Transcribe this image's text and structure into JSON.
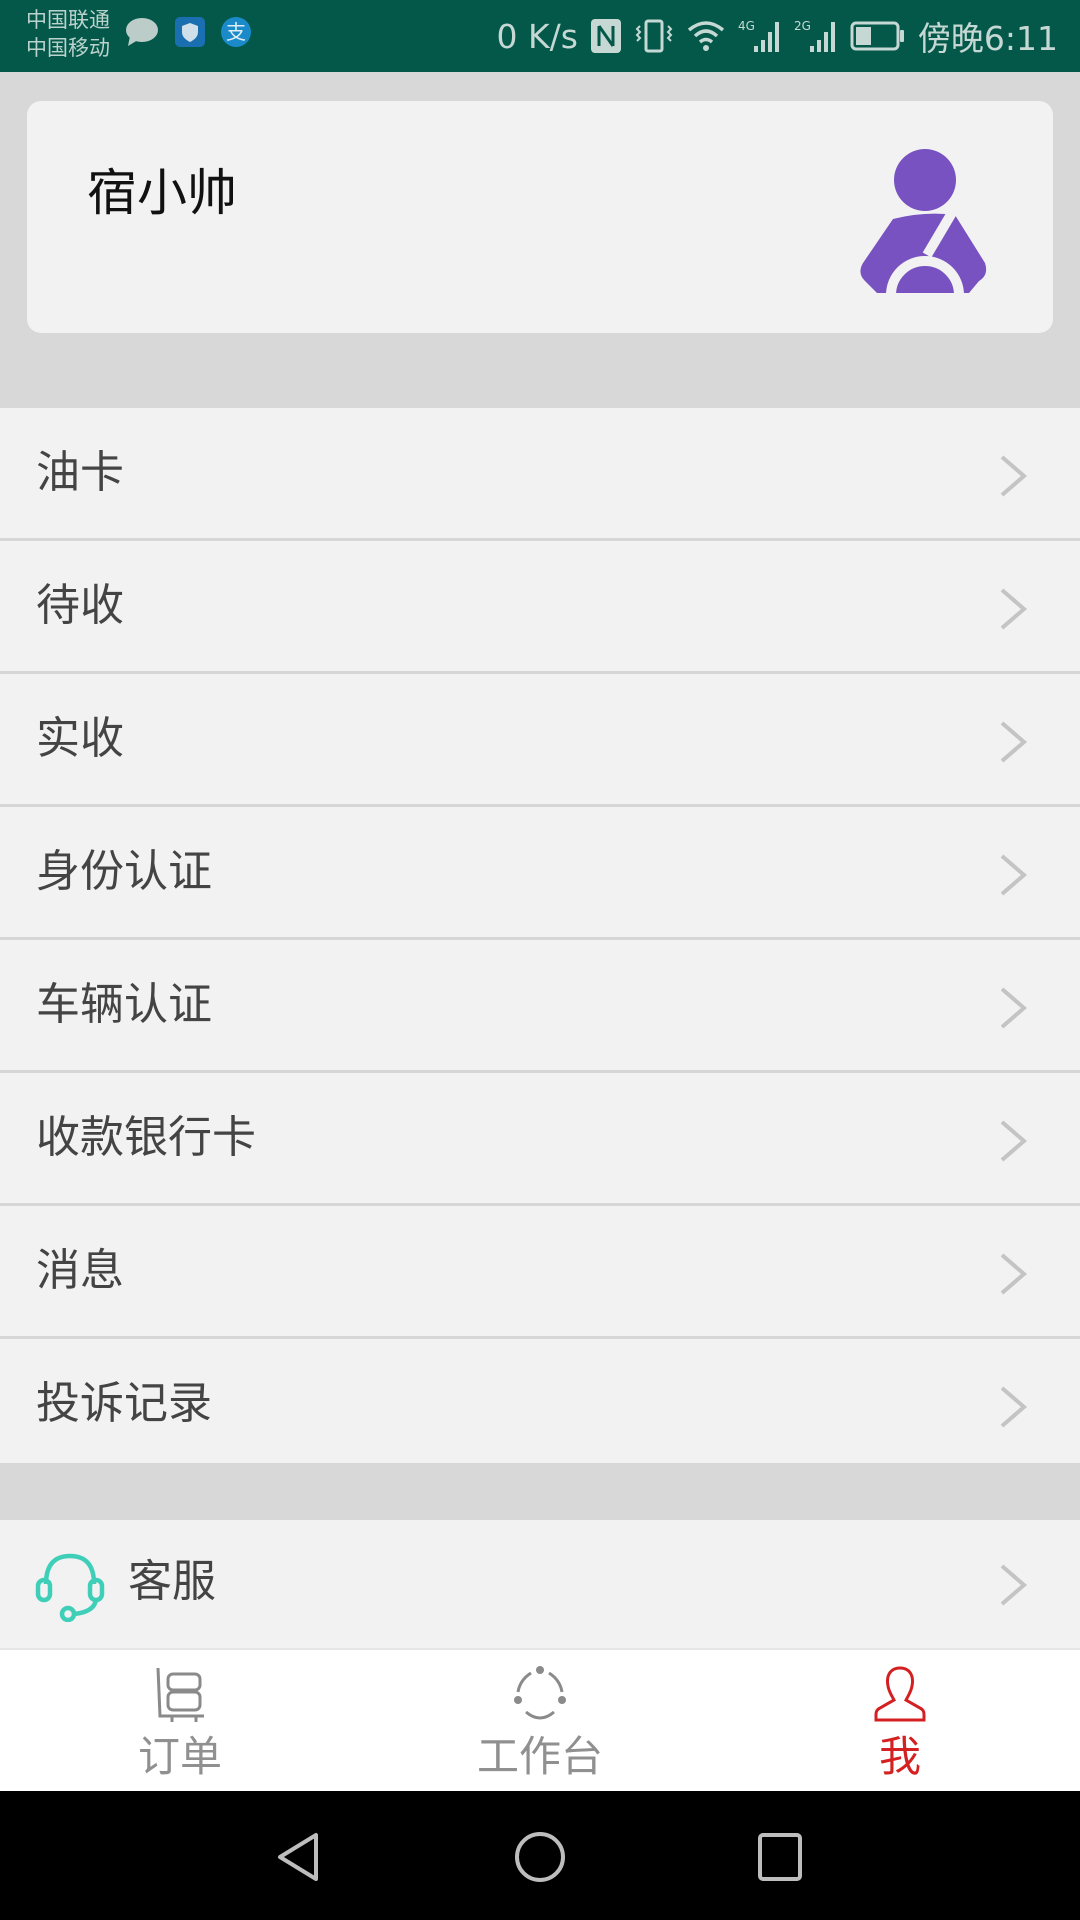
{
  "status_bar": {
    "carrier_1": "中国联通",
    "carrier_2": "中国移动",
    "left_icons": [
      "message-icon",
      "security-shield-icon",
      "alipay-icon"
    ],
    "net_speed": "0 K/s",
    "right_icons": [
      "nfc-icon",
      "vibrate-icon",
      "wifi-icon",
      "signal-4g-icon",
      "signal-2g-icon",
      "battery-icon"
    ],
    "signal_1_label": "4G",
    "signal_2_label": "2G",
    "battery_level": 0.4,
    "time": "傍晚6:11"
  },
  "profile": {
    "name": "宿小帅",
    "avatar_icon": "driver-avatar-icon",
    "accent_color": "#7852c0"
  },
  "menu": {
    "items": [
      {
        "label": "油卡",
        "icon": "chevron-right-icon"
      },
      {
        "label": "待收",
        "icon": "chevron-right-icon"
      },
      {
        "label": "实收",
        "icon": "chevron-right-icon"
      },
      {
        "label": "身份认证",
        "icon": "chevron-right-icon"
      },
      {
        "label": "车辆认证",
        "icon": "chevron-right-icon"
      },
      {
        "label": "收款银行卡",
        "icon": "chevron-right-icon"
      },
      {
        "label": "消息",
        "icon": "chevron-right-icon"
      },
      {
        "label": "投诉记录",
        "icon": "chevron-right-icon"
      }
    ]
  },
  "service": {
    "label": "客服",
    "icon": "headset-icon",
    "icon_color": "#3fcfb8"
  },
  "tabbar": {
    "tabs": [
      {
        "label": "订单",
        "icon": "cart-icon",
        "active": false
      },
      {
        "label": "工作台",
        "icon": "workbench-icon",
        "active": false
      },
      {
        "label": "我",
        "icon": "person-icon",
        "active": true
      }
    ],
    "active_color": "#d42020",
    "inactive_color": "#909090"
  },
  "nav_bar": {
    "buttons": [
      "back-icon",
      "home-icon",
      "recents-icon"
    ]
  }
}
